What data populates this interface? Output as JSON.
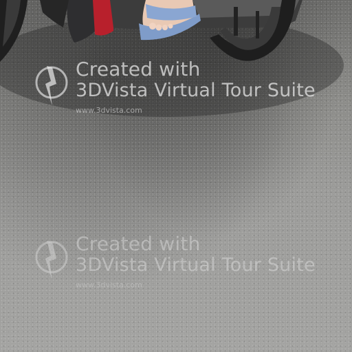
{
  "watermarks": [
    {
      "line1": "Created with",
      "line2": "3DVista Virtual Tour Suite",
      "url": "www.3dvista.com"
    },
    {
      "line1": "Created with",
      "line2": "3DVista Virtual Tour Suite",
      "url": "www.3dvista.com"
    }
  ],
  "colors": {
    "asphalt": "#9a9a98",
    "shadow": "#4a4a48",
    "sandal": "#7f9cc9",
    "tire": "#2a2a2a",
    "brake_red": "#b8202c"
  }
}
